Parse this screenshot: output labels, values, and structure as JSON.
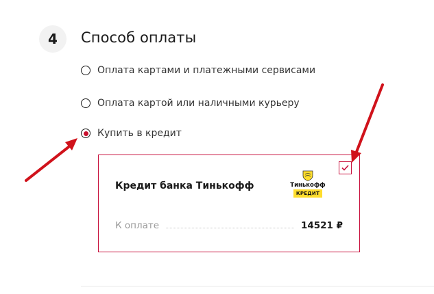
{
  "section": {
    "step_number": "4",
    "title": "Способ оплаты"
  },
  "payment_options": [
    {
      "label": "Оплата картами и платежными сервисами",
      "selected": false
    },
    {
      "label": "Оплата картой или наличными курьеру",
      "selected": false
    },
    {
      "label": "Купить в кредит",
      "selected": true
    }
  ],
  "credit_card": {
    "title": "Кредит банка Тинькофф",
    "logo_name": "Тинькофф",
    "logo_badge": "КРЕДИТ",
    "checked": true,
    "pay_label": "К оплате",
    "pay_amount": "14521 ₽"
  },
  "colors": {
    "accent": "#c8103c",
    "annotation_arrow": "#d0121b",
    "logo_yellow": "#ffdd2d"
  }
}
